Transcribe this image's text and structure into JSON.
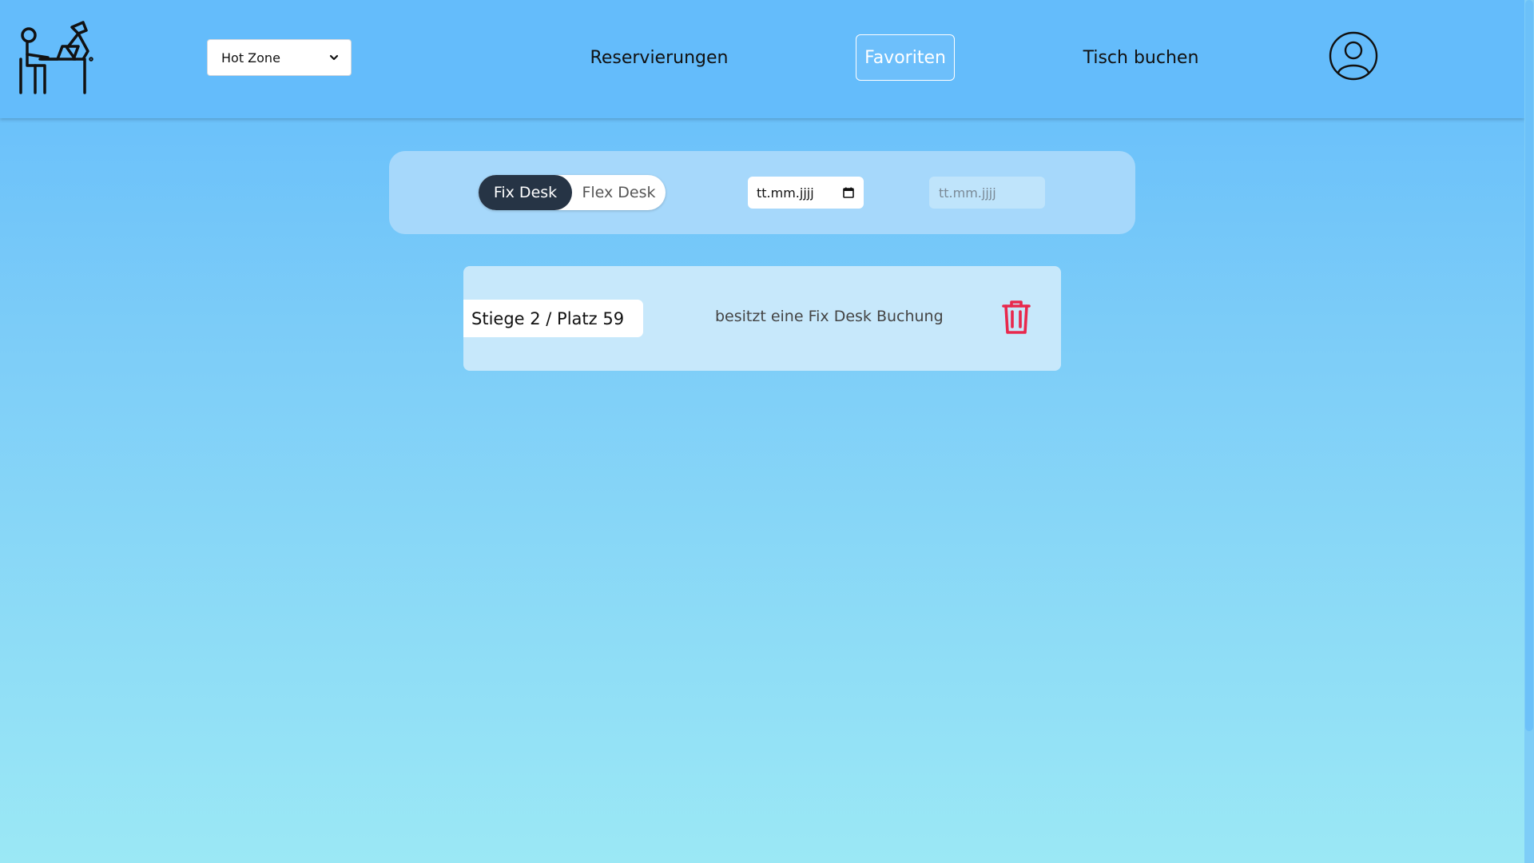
{
  "header": {
    "logo_icon": "desk-worker-icon",
    "zone_select": {
      "value": "Hot Zone",
      "icon": "chevron-down-icon"
    },
    "nav": {
      "reservations": "Reservierungen",
      "favorites": "Favoriten",
      "book_table": "Tisch buchen"
    },
    "profile_icon": "user-profile-icon",
    "active_nav": "Favoriten"
  },
  "filter": {
    "toggle": {
      "fix": "Fix Desk",
      "flex": "Flex Desk",
      "active": "Fix Desk"
    },
    "date_from": {
      "placeholder": "tt.mm.jjjj",
      "icon": "calendar-icon"
    },
    "date_to": {
      "placeholder": "tt.mm.jjjj"
    }
  },
  "favorites": [
    {
      "desk": "Stiege 2 / Platz 59",
      "status": "besitzt eine Fix Desk Buchung",
      "action_icon": "trash-icon"
    }
  ],
  "colors": {
    "header_bg": "#64bcfb",
    "toggle_active": "#263445",
    "delete": "#e8284d",
    "panel_bg": "#a6d8fb",
    "card_bg": "#c7e8fb"
  }
}
